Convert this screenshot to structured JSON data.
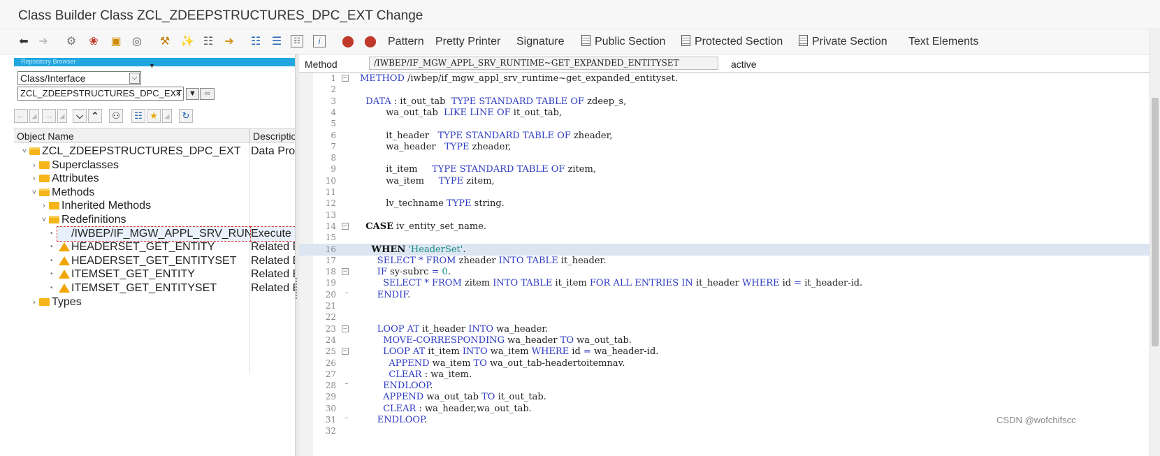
{
  "window": {
    "title": "Class Builder Class ZCL_ZDEEPSTRUCTURES_DPC_EXT Change"
  },
  "toolbar": {
    "icons": [
      "back-icon",
      "forward-icon",
      "switch-display-change-icon",
      "other-object-icon",
      "check-icon",
      "activate-icon",
      "test-icon",
      "where-used-icon",
      "display-object-list-icon",
      "navigation-window-icon",
      "hierarchy-icon",
      "help-icon",
      "information-icon",
      "breakpoint-icon",
      "session-breakpoint-icon"
    ],
    "buttons": {
      "pattern": "Pattern",
      "pretty_printer": "Pretty Printer",
      "signature": "Signature",
      "public_section": "Public Section",
      "protected_section": "Protected Section",
      "private_section": "Private Section",
      "text_elements": "Text Elements"
    }
  },
  "repository_browser": {
    "header": "Repository Browser",
    "object_type": "Class/Interface",
    "object_name": "ZCL_ZDEEPSTRUCTURES_DPC_EXT",
    "clear_symbol": "×",
    "columns": {
      "name": "Object Name",
      "description": "Description"
    },
    "tree": [
      {
        "label": "ZCL_ZDEEPSTRUCTURES_DPC_EXT",
        "description": "Data Provide",
        "icon": "folder-open-icon",
        "level": 0,
        "toggle": "˅"
      },
      {
        "label": "Superclasses",
        "description": "",
        "icon": "folder-icon",
        "level": 1,
        "toggle": "›"
      },
      {
        "label": "Attributes",
        "description": "",
        "icon": "folder-icon",
        "level": 1,
        "toggle": "›"
      },
      {
        "label": "Methods",
        "description": "",
        "icon": "folder-open-icon",
        "level": 1,
        "toggle": "˅"
      },
      {
        "label": "Inherited Methods",
        "description": "",
        "icon": "folder-icon",
        "level": 2,
        "toggle": "›"
      },
      {
        "label": "Redefinitions",
        "description": "",
        "icon": "folder-open-icon",
        "level": 2,
        "toggle": "˅"
      },
      {
        "label": "/IWBEP/IF_MGW_APPL_SRV_RUNTIME~GET_EXPANDED_ENTITYSET",
        "description": "Execute a R",
        "icon": "implemented-method-icon",
        "level": 3,
        "selected": true
      },
      {
        "label": "HEADERSET_GET_ENTITY",
        "description": "Related Enti",
        "icon": "warning-icon",
        "level": 3
      },
      {
        "label": "HEADERSET_GET_ENTITYSET",
        "description": "Related Enti",
        "icon": "warning-icon",
        "level": 3
      },
      {
        "label": "ITEMSET_GET_ENTITY",
        "description": "Related Enti",
        "icon": "warning-icon",
        "level": 3
      },
      {
        "label": "ITEMSET_GET_ENTITYSET",
        "description": "Related Enti",
        "icon": "warning-icon",
        "level": 3
      },
      {
        "label": "Types",
        "description": "",
        "icon": "folder-icon",
        "level": 1,
        "toggle": "›"
      }
    ]
  },
  "editor": {
    "method_label": "Method",
    "method_name": "/IWBEP/IF_MGW_APPL_SRV_RUNTIME~GET_EXPANDED_ENTITYSET",
    "status": "active",
    "highlighted_line": 16,
    "lines": [
      "METHOD /iwbep/if_mgw_appl_srv_runtime~get_expanded_entityset.",
      "",
      "  DATA : it_out_tab  TYPE STANDARD TABLE OF zdeep_s,",
      "         wa_out_tab  LIKE LINE OF it_out_tab,",
      "",
      "         it_header   TYPE STANDARD TABLE OF zheader,",
      "         wa_header   TYPE zheader,",
      "",
      "         it_item     TYPE STANDARD TABLE OF zitem,",
      "         wa_item     TYPE zitem,",
      "",
      "         lv_techname TYPE string.",
      "",
      "  CASE iv_entity_set_name.",
      "",
      "    WHEN 'HeaderSet'.",
      "      SELECT * FROM zheader INTO TABLE it_header.",
      "      IF sy-subrc = 0.",
      "        SELECT * FROM zitem INTO TABLE it_item FOR ALL ENTRIES IN it_header WHERE id = it_header-id.",
      "      ENDIF.",
      "",
      "",
      "      LOOP AT it_header INTO wa_header.",
      "        MOVE-CORRESPONDING wa_header TO wa_out_tab.",
      "        LOOP AT it_item INTO wa_item WHERE id = wa_header-id.",
      "          APPEND wa_item TO wa_out_tab-headertoitemnav.",
      "          CLEAR : wa_item.",
      "        ENDLOOP.",
      "        APPEND wa_out_tab TO it_out_tab.",
      "        CLEAR : wa_header,wa_out_tab.",
      "      ENDLOOP.",
      ""
    ]
  },
  "watermark": "CSDN @wofchifscc"
}
